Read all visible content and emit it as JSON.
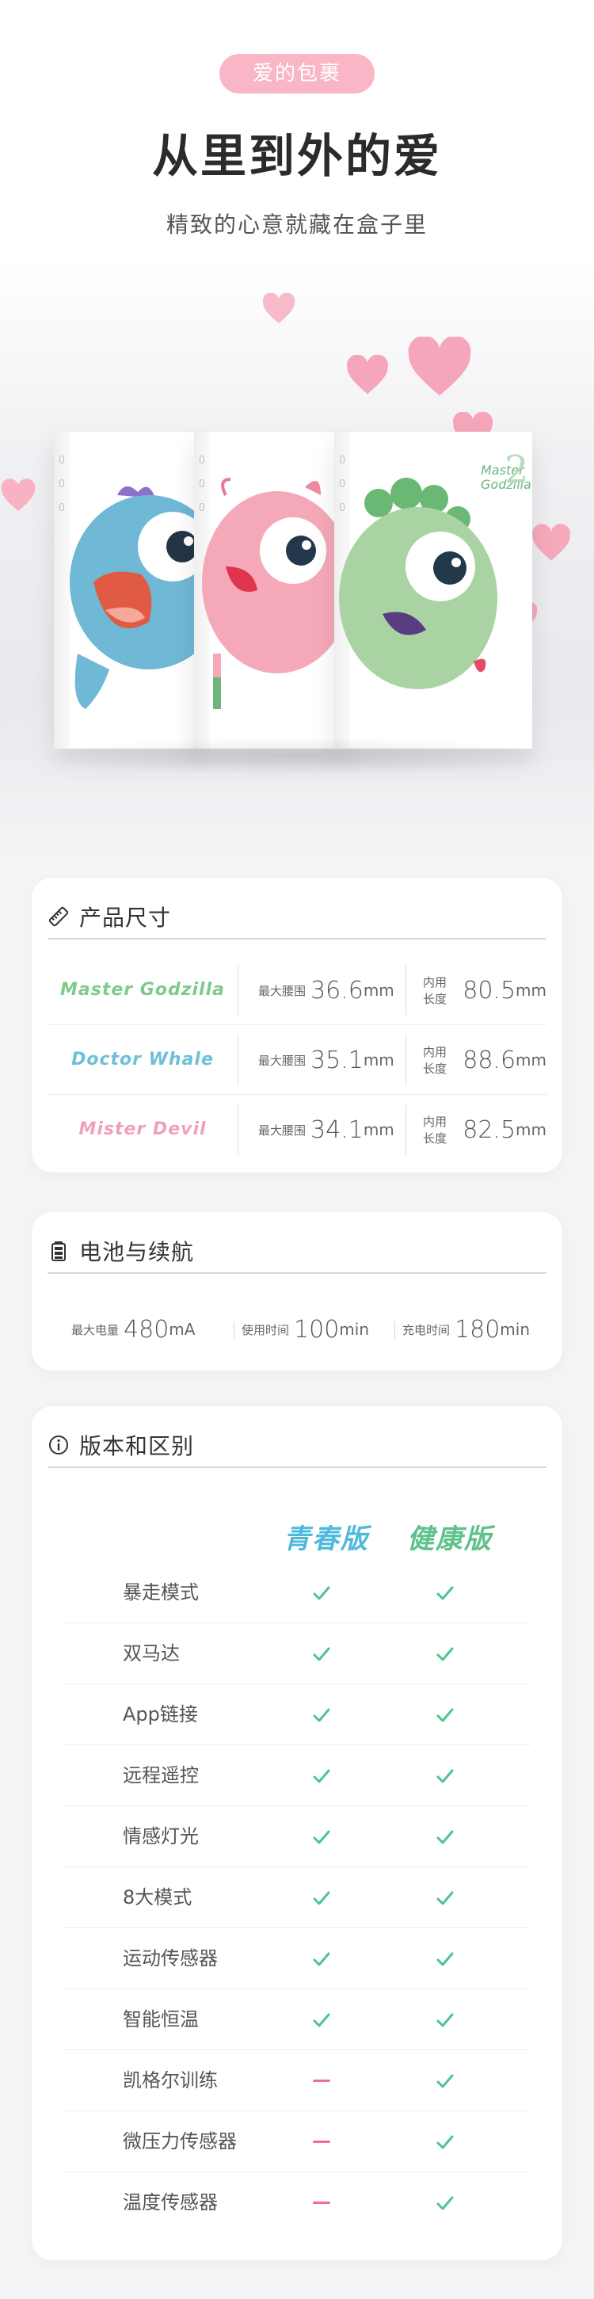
{
  "hero": {
    "badge": "爱的包裹",
    "headline": "从里到外的爱",
    "subline": "精致的心意就藏在盒子里",
    "box_label": "Master Godzilla",
    "box_number": "2"
  },
  "size_card": {
    "title": "产品尺寸",
    "icon": "ruler-icon",
    "waist_label": "最大腰围",
    "inner_label": "内用长度",
    "unit": "mm",
    "rows": [
      {
        "name": "Master Godzilla",
        "color": "#7ccb8a",
        "waist": "36.6",
        "inner": "80.5"
      },
      {
        "name": "Doctor Whale",
        "color": "#6dc0d8",
        "waist": "35.1",
        "inner": "88.6"
      },
      {
        "name": "Mister Devil",
        "color": "#f1a0bb",
        "waist": "34.1",
        "inner": "82.5"
      }
    ]
  },
  "battery_card": {
    "title": "电池与续航",
    "icon": "battery-icon",
    "specs": [
      {
        "label": "最大电量",
        "value": "480",
        "unit": "mA"
      },
      {
        "label": "使用时间",
        "value": "100",
        "unit": "min"
      },
      {
        "label": "充电时间",
        "value": "180",
        "unit": "min"
      }
    ]
  },
  "version_card": {
    "title": "版本和区别",
    "icon": "info-icon",
    "columns": [
      {
        "name": "青春版",
        "color": "#4fb9dd"
      },
      {
        "name": "健康版",
        "color": "#5ec28a"
      }
    ],
    "colors": {
      "check": "#4fc48d",
      "dash": "#ef6f8b"
    },
    "features": [
      {
        "label": "暴走模式",
        "youth": true,
        "health": true
      },
      {
        "label": "双马达",
        "youth": true,
        "health": true
      },
      {
        "label": "App链接",
        "youth": true,
        "health": true
      },
      {
        "label": "远程遥控",
        "youth": true,
        "health": true
      },
      {
        "label": "情感灯光",
        "youth": true,
        "health": true
      },
      {
        "label": "8大模式",
        "youth": true,
        "health": true
      },
      {
        "label": "运动传感器",
        "youth": true,
        "health": true
      },
      {
        "label": "智能恒温",
        "youth": true,
        "health": true
      },
      {
        "label": "凯格尔训练",
        "youth": false,
        "health": true
      },
      {
        "label": "微压力传感器",
        "youth": false,
        "health": true
      },
      {
        "label": "温度传感器",
        "youth": false,
        "health": true
      }
    ]
  }
}
